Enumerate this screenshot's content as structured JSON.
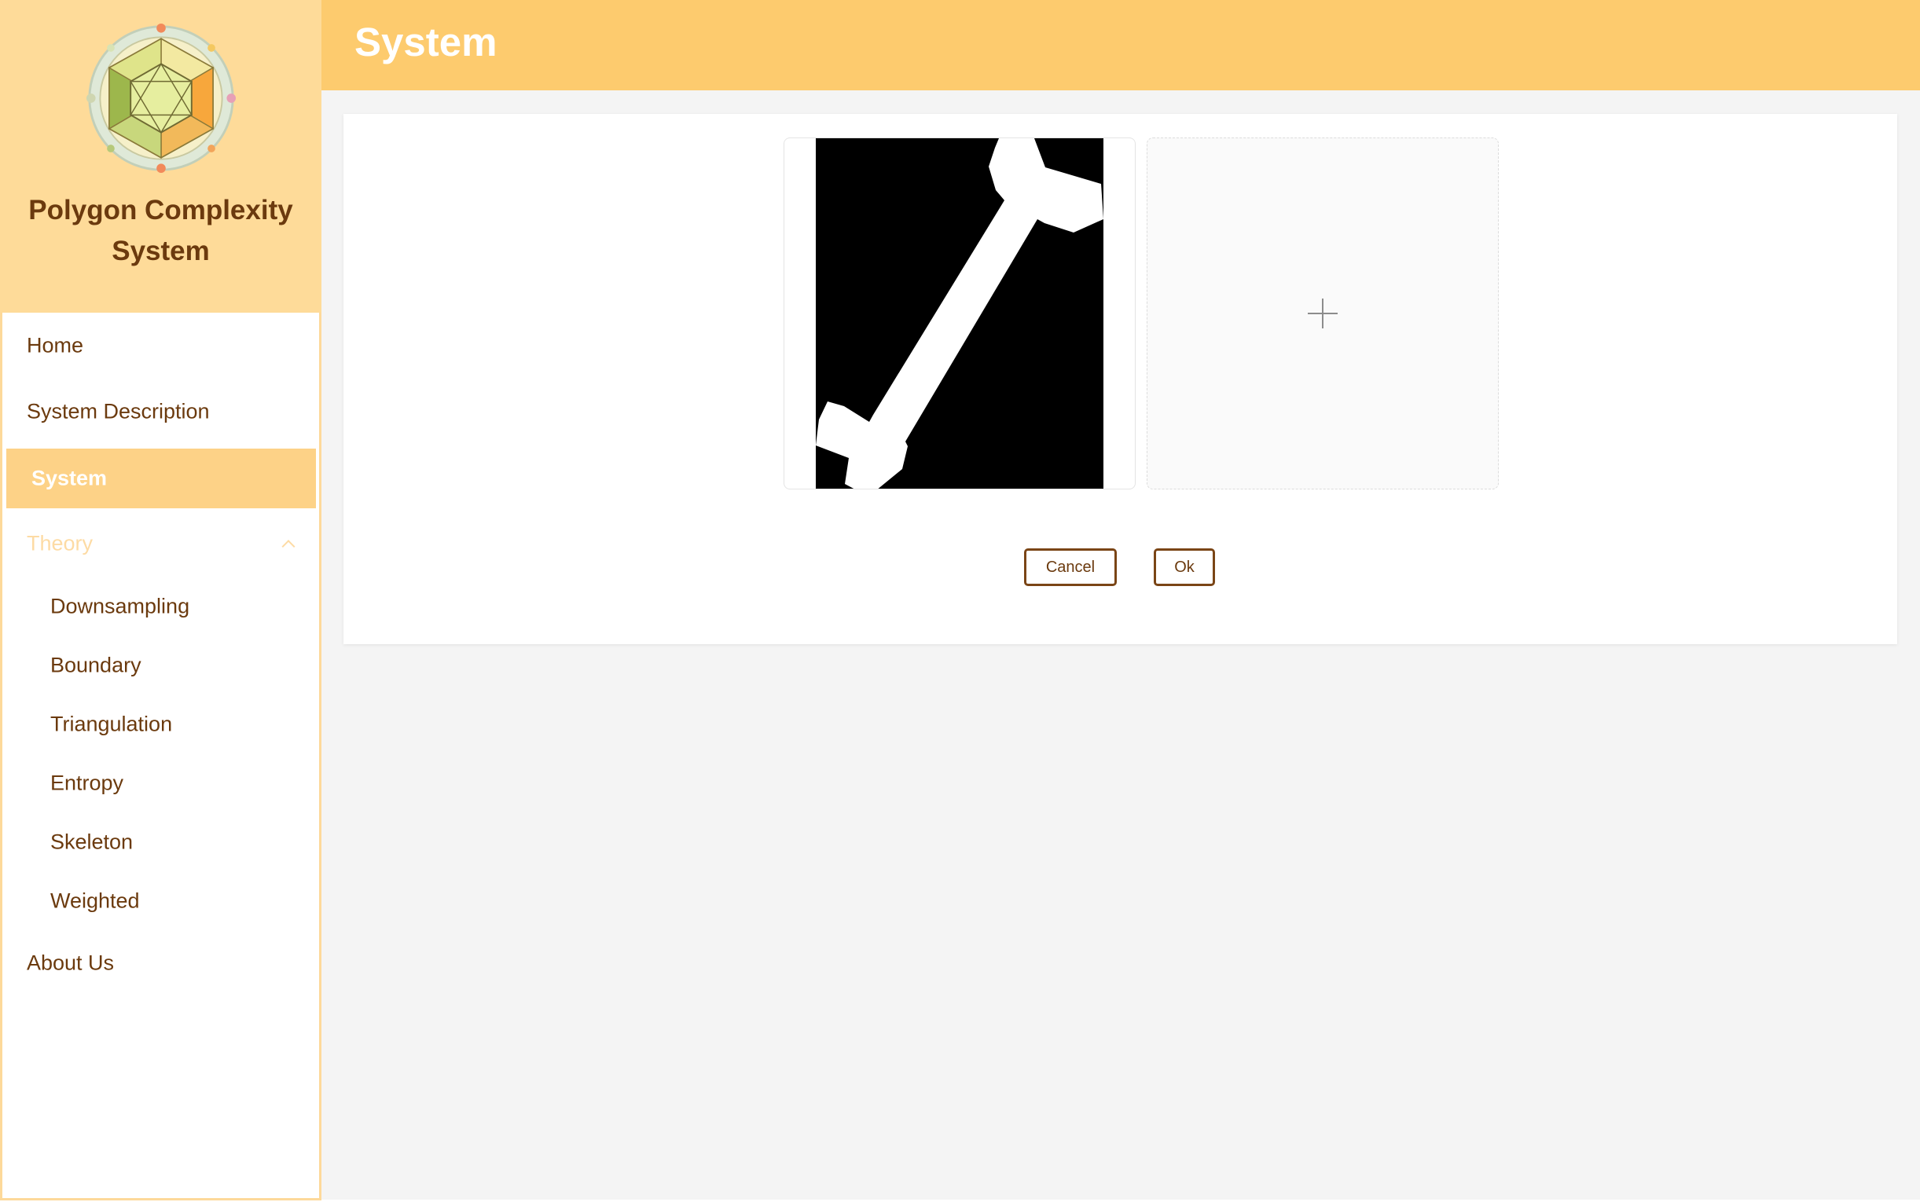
{
  "app": {
    "title": "Polygon Complexity System",
    "logo_icon": "polygon-mandala-logo"
  },
  "header": {
    "title": "System"
  },
  "sidebar": {
    "items": [
      {
        "label": "Home"
      },
      {
        "label": "System Description"
      },
      {
        "label": "System",
        "active": true
      },
      {
        "label": "Theory",
        "expanded": true,
        "icon": "chevron-up-icon"
      }
    ],
    "theory_children": [
      {
        "label": "Downsampling"
      },
      {
        "label": "Boundary"
      },
      {
        "label": "Triangulation"
      },
      {
        "label": "Entropy"
      },
      {
        "label": "Skeleton"
      },
      {
        "label": "Weighted"
      }
    ],
    "footer_items": [
      {
        "label": "About Us"
      }
    ]
  },
  "upload": {
    "image_description_icon": "bone-silhouette-image",
    "add_icon": "plus-icon"
  },
  "actions": {
    "cancel_label": "Cancel",
    "ok_label": "Ok"
  },
  "colors": {
    "header_bg": "#fdcb6e",
    "brand_bg": "#fedb99",
    "active_bg": "#fdd287",
    "text_brown": "#6b3a0e",
    "page_bg": "#f4f4f4"
  }
}
